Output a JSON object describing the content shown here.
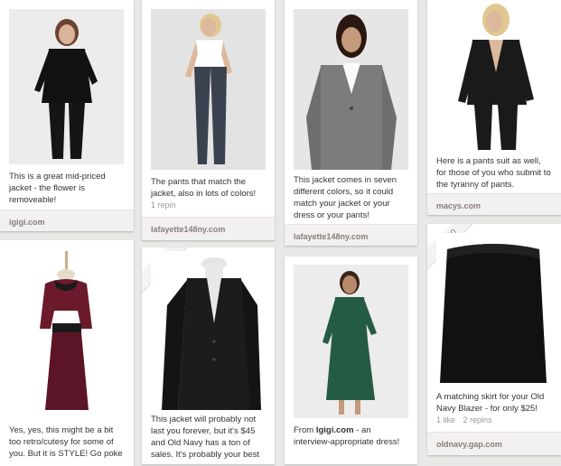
{
  "pins": [
    {
      "id": "p1",
      "description": "This is a great mid-priced jacket - the flower is removeable!",
      "source": "igigi.com"
    },
    {
      "id": "p2",
      "description": "The pants that match the jacket, also in lots of colors!",
      "meta": [
        "1 repin"
      ],
      "source": "lafayette148ny.com"
    },
    {
      "id": "p3",
      "description": "This jacket comes in seven different colors, so it could match your jacket or your dress or your pants!",
      "source": "lafayette148ny.com"
    },
    {
      "id": "p4",
      "description": "Here is a pants suit as well, for those of you who submit to the tyranny of pants.",
      "source": "macys.com"
    },
    {
      "id": "p5",
      "description": "Yes, yes, this might be a bit too retro/cutesy for some of you. But it is STYLE! Go poke"
    },
    {
      "id": "p6",
      "price": "$45.00",
      "description": "This jacket will probably not last you forever, but it's $45 and Old Navy has a ton of sales. It's probably your best"
    },
    {
      "id": "p7",
      "description": "From Igigi.com - an interview-appropriate dress!"
    },
    {
      "id": "p8",
      "price": "$25.00",
      "description": "A matching skirt for your Old Navy Blazer - for only $25!",
      "meta": [
        "1 like",
        "2 repins"
      ],
      "source": "oldnavy.gap.com"
    }
  ],
  "icons": {
    "p1": "woman-black-suit-photo",
    "p2": "woman-trousers-photo",
    "p3": "woman-gray-blazer-photo",
    "p4": "woman-black-pantsuit-photo",
    "p5": "burgundy-dress-photo",
    "p6": "black-blazer-photo",
    "p7": "green-dress-photo",
    "p8": "black-skirt-photo"
  },
  "colors": {
    "background": "#e9e8e6",
    "card": "#ffffff",
    "source_bar": "#f2f0f0",
    "source_text": "#8c7b7b"
  }
}
